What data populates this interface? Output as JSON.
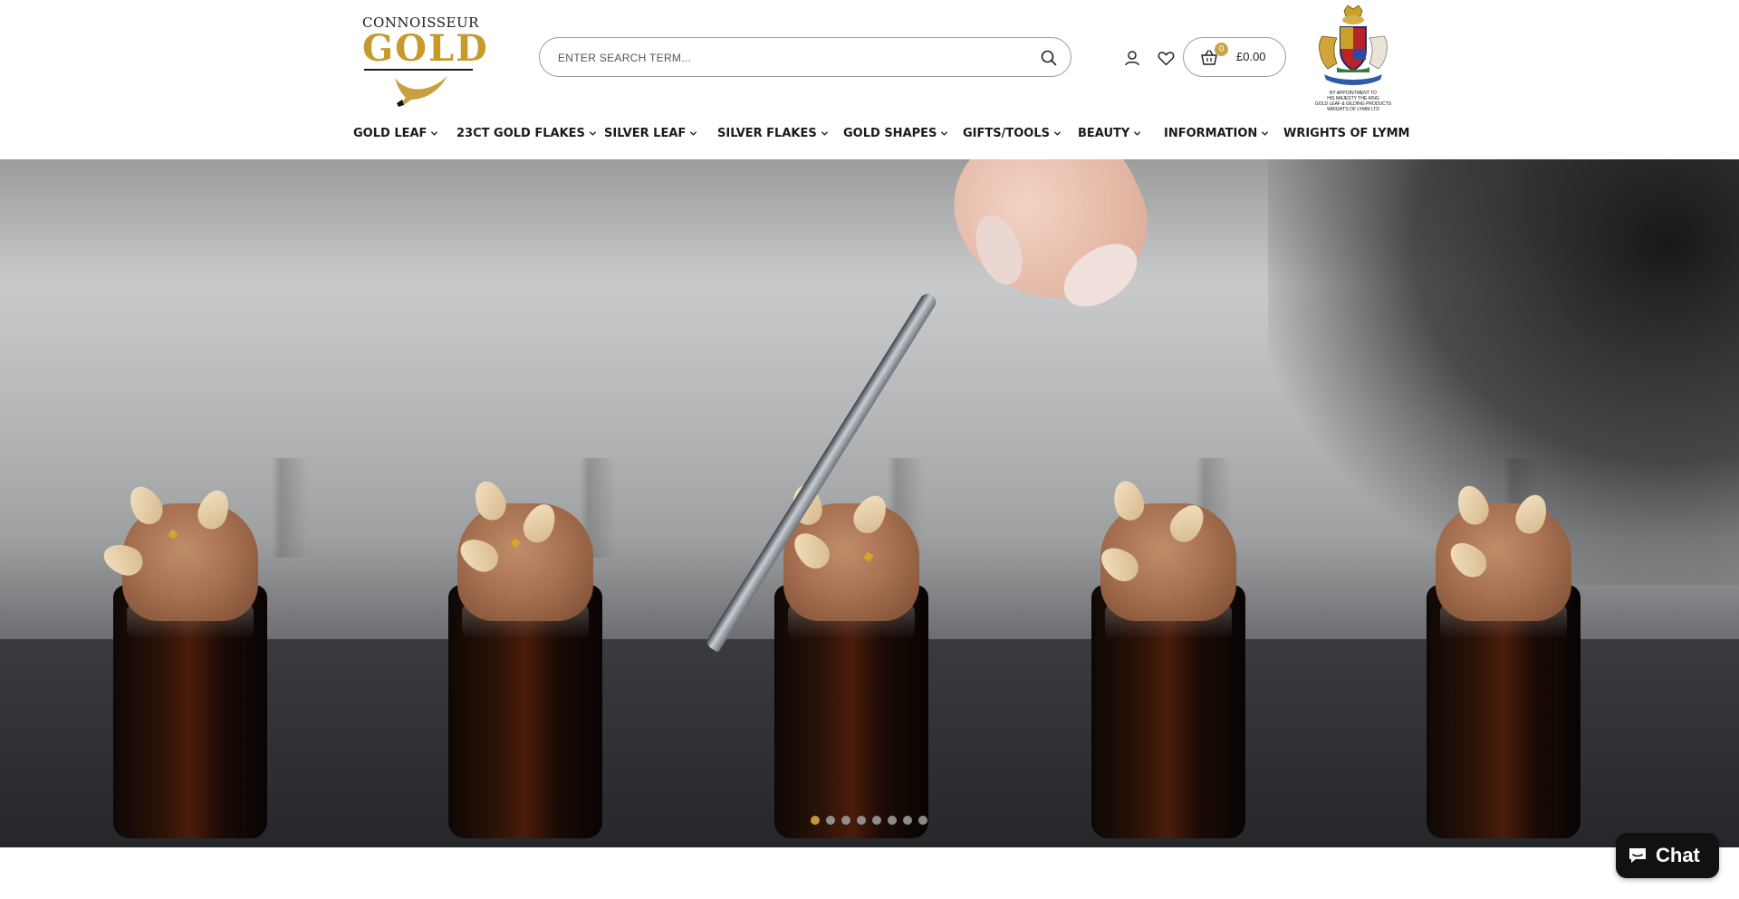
{
  "header": {
    "logo": {
      "top_text": "CONNOISSEUR",
      "main_text": "GOLD"
    },
    "search": {
      "placeholder": "ENTER SEARCH TERM..."
    },
    "cart": {
      "count": "0",
      "total": "£0.00"
    },
    "royal_warrant": {
      "text_lines": [
        "BY APPOINTMENT TO",
        "HIS MAJESTY THE KING",
        "GOLD LEAF & GILDING PRODUCTS",
        "WRIGHTS OF LYMM LTD"
      ]
    },
    "icons": {
      "search": "search-icon",
      "account": "user-icon",
      "wishlist": "heart-icon",
      "cart": "basket-icon"
    }
  },
  "nav": {
    "items": [
      {
        "label": "GOLD LEAF",
        "has_dropdown": true
      },
      {
        "label": "23CT GOLD FLAKES",
        "has_dropdown": true
      },
      {
        "label": "SILVER LEAF",
        "has_dropdown": true
      },
      {
        "label": "SILVER FLAKES",
        "has_dropdown": true
      },
      {
        "label": "GOLD SHAPES",
        "has_dropdown": true
      },
      {
        "label": "GIFTS/TOOLS",
        "has_dropdown": true
      },
      {
        "label": "BEAUTY",
        "has_dropdown": true
      },
      {
        "label": "INFORMATION",
        "has_dropdown": true
      },
      {
        "label": "WRIGHTS OF LYMM",
        "has_dropdown": false
      }
    ]
  },
  "hero": {
    "slide_count": 8,
    "active_slide": 1
  },
  "chat": {
    "label": "Chat"
  },
  "colors": {
    "accent_gold": "#c9a24a",
    "dot_active": "#d4a937",
    "chat_bg": "#111111"
  }
}
